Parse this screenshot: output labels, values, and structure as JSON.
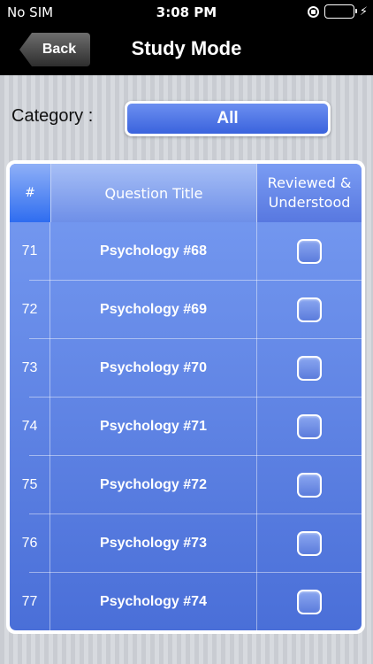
{
  "status_bar": {
    "carrier": "No SIM",
    "time": "3:08 PM",
    "charging_glyph": "⚡"
  },
  "nav": {
    "back_label": "Back",
    "title": "Study Mode"
  },
  "category": {
    "label": "Category :",
    "selected": "All"
  },
  "table": {
    "headers": {
      "number": "#",
      "title": "Question Title",
      "reviewed_line1": "Reviewed &",
      "reviewed_line2": "Understood"
    },
    "rows": [
      {
        "number": "71",
        "title": "Psychology #68",
        "reviewed": false
      },
      {
        "number": "72",
        "title": "Psychology #69",
        "reviewed": false
      },
      {
        "number": "73",
        "title": "Psychology #70",
        "reviewed": false
      },
      {
        "number": "74",
        "title": "Psychology #71",
        "reviewed": false
      },
      {
        "number": "75",
        "title": "Psychology #72",
        "reviewed": false
      },
      {
        "number": "76",
        "title": "Psychology #73",
        "reviewed": false
      },
      {
        "number": "77",
        "title": "Psychology #74",
        "reviewed": false
      }
    ]
  },
  "colors": {
    "accent": "#3a63dd",
    "battery": "#4cd964"
  }
}
